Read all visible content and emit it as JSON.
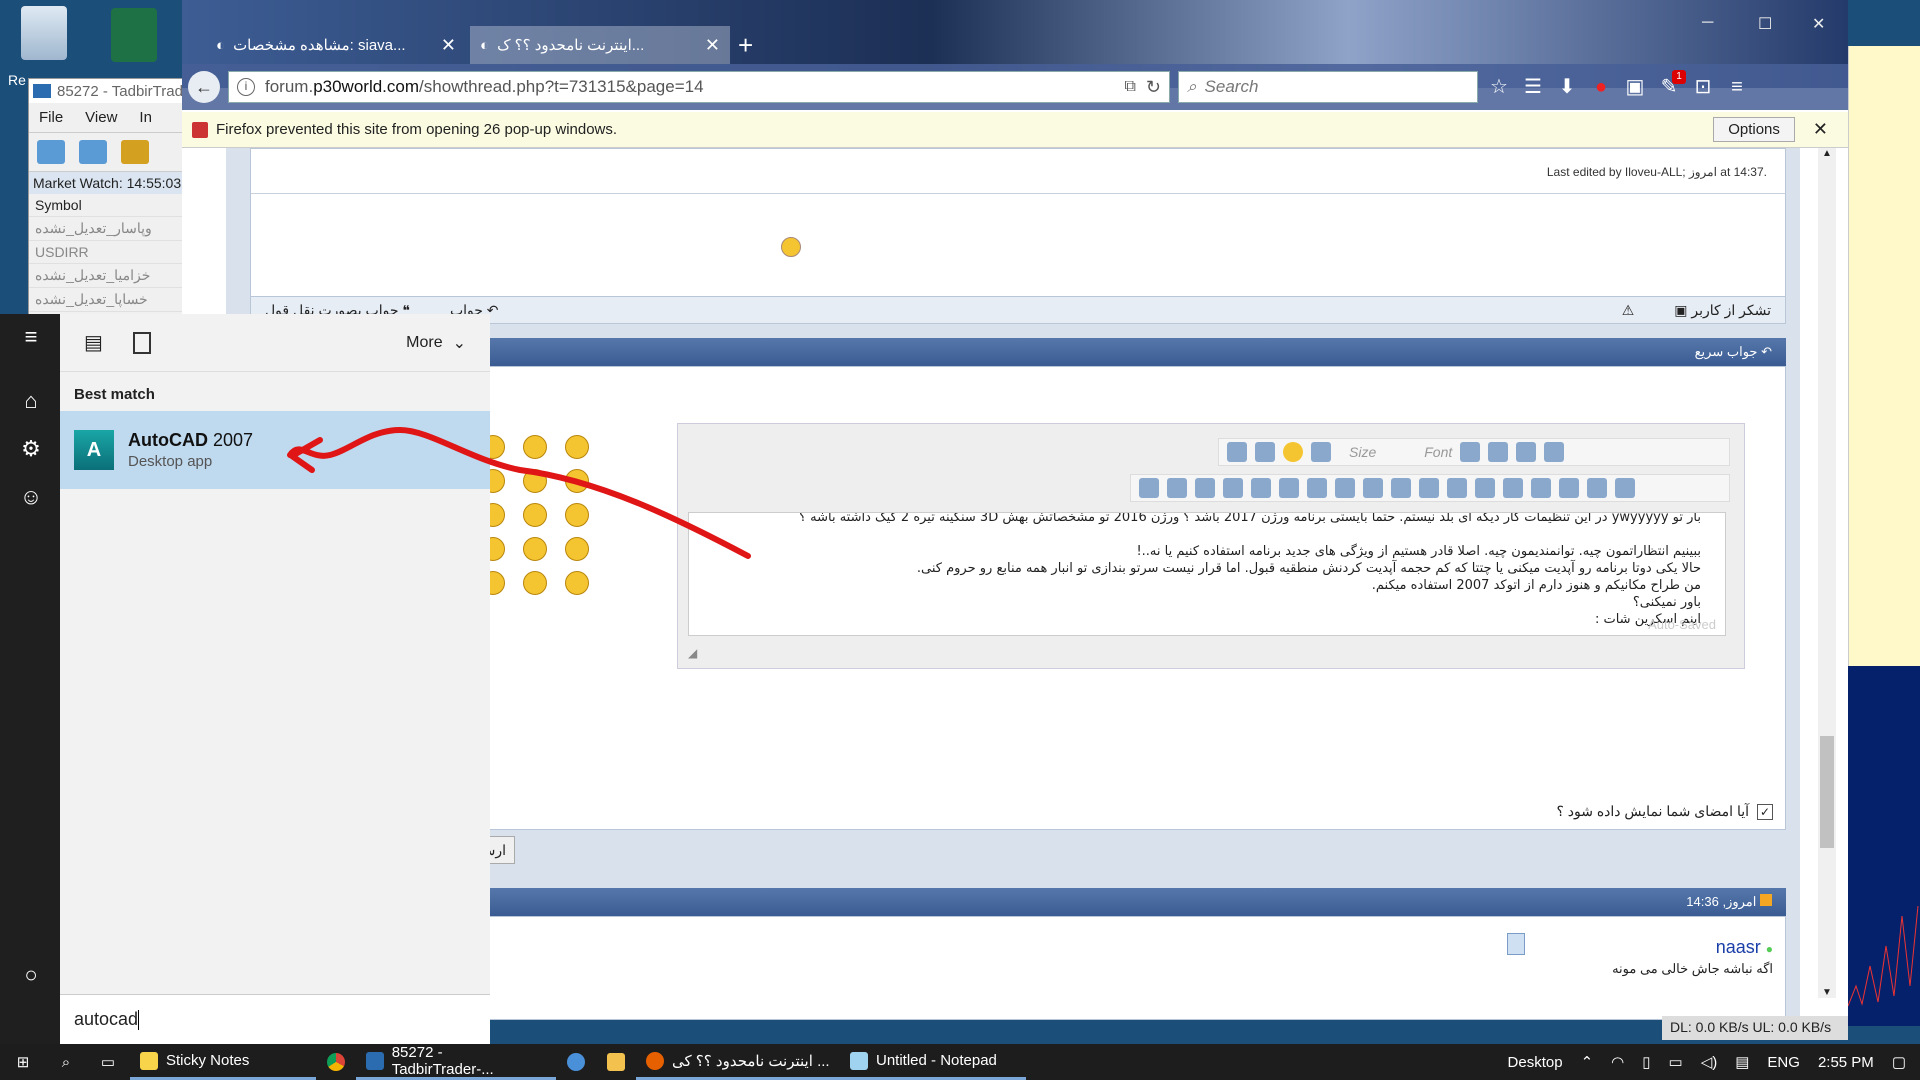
{
  "desktop": {
    "recycle_label": "Re",
    "excel_label": ""
  },
  "tadbir": {
    "title": "85272 - TadbirTrad",
    "menu": [
      "File",
      "View",
      "In"
    ],
    "market_watch": "Market Watch: 14:55:03",
    "symbol_header": "Symbol",
    "symbols": [
      "وپاسار_تعدیل_نشده",
      "USDIRR",
      "خزامیا_تعدیل_نشده",
      "خساپا_تعدیل_نشده"
    ]
  },
  "firefox": {
    "tabs": [
      {
        "label": "مشاهده مشخصات: siava..."
      },
      {
        "label": "اینترنت نامحدود ؟؟ ک..."
      }
    ],
    "url_prefix": "forum.",
    "url_domain": "p30world.com",
    "url_path": "/showthread.php?t=731315&page=14",
    "search_placeholder": "Search",
    "notification_badge": "1",
    "popup_message": "Firefox prevented this site from opening 26 pop-up windows.",
    "popup_options": "Options"
  },
  "forum": {
    "edit_line": "Last edited by Iloveu-ALL; امروز at 14:37.",
    "thanks": "تشکر از کاربر",
    "reply": "جواب",
    "reply_quote": "جواب بصورت نقل قول",
    "quick_reply": "جواب سریع",
    "editor_size": "Size",
    "editor_font": "Font",
    "editor_lines": [
      "بار تو ywyyyyy در این تنظیمات کار دیگه ای بلد نیستم. حتما بایستی برنامه ورژن 2017 باشد ؟ ورژن 2016 تو مشخصاتش بهش 3D سنگینه تیره 2 گیگ داشته باشه ؟",
      "",
      "ببینیم انتظاراتمون چیه. توانمندیمون چیه. اصلا قادر هستیم از ویژگی های جدید برنامه استفاده کنیم یا نه..!",
      "حالا یکی دوتا برنامه رو آپدیت میکنی یا چتتا که کم حجمه آپدیت کردنش منطقیه قبول. اما قرار نیست سرتو بندازی تو انبار همه منابع رو حروم کنی.",
      "من طراح مکانیکم و هنوز دارم از اتوکد 2007 استفاده میکنم.",
      "باور نمیکنی؟",
      "اینم اسکرین شات :"
    ],
    "autosaved": "Auto-Saved",
    "signature_question": "آیا امضای شما نمایش داده شود ؟",
    "send_button": "ارسال جواب سر",
    "post2_time": "امروز, 14:36",
    "post2_user": "naasr",
    "post2_text": "اگه نباشه جاش خالی می مونه"
  },
  "network": {
    "status": "DL: 0.0 KB/s   UL: 0.0 KB/s"
  },
  "start_menu": {
    "more": "More",
    "best_match": "Best match",
    "result_name_bold": "AutoCAD",
    "result_name_rest": " 2007",
    "result_type": "Desktop app",
    "query": "autocad"
  },
  "taskbar": {
    "items": [
      {
        "label": "Sticky Notes"
      },
      {
        "label": "85272 - TadbirTrader-..."
      },
      {
        "label": "اینترنت نامحدود ؟؟ کی ..."
      },
      {
        "label": "Untitled - Notepad"
      }
    ],
    "desktop_label": "Desktop",
    "lang": "ENG",
    "time": "2:55 PM"
  }
}
